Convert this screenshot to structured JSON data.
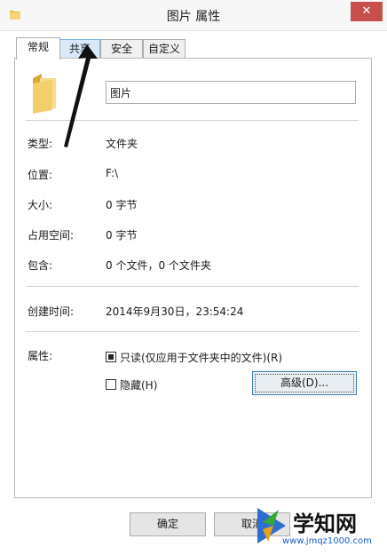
{
  "window": {
    "title": "图片 属性",
    "close_glyph": "✕"
  },
  "tabs": [
    {
      "label": "常规"
    },
    {
      "label": "共享"
    },
    {
      "label": "安全"
    },
    {
      "label": "自定义"
    }
  ],
  "general": {
    "name_value": "图片",
    "type_label": "类型:",
    "type_value": "文件夹",
    "location_label": "位置:",
    "location_value": "F:\\",
    "size_label": "大小:",
    "size_value": "0 字节",
    "disk_label": "占用空间:",
    "disk_value": "0 字节",
    "contains_label": "包含:",
    "contains_value": "0 个文件，0 个文件夹",
    "created_label": "创建时间:",
    "created_value": "2014年9月30日，23:54:24",
    "attributes_label": "属性:",
    "readonly_label": "只读(仅应用于文件夹中的文件)(R)",
    "readonly_checked": true,
    "hidden_label": "隐藏(H)",
    "hidden_checked": false,
    "advanced_label": "高级(D)..."
  },
  "footer": {
    "ok_label": "确定",
    "cancel_label": "取消"
  },
  "watermark": {
    "text": "学知网",
    "url": "www.jmqz1000.com"
  },
  "colors": {
    "close": "#c7504e",
    "folder": "#f3cf6b",
    "accent": "#3c7fb1"
  }
}
